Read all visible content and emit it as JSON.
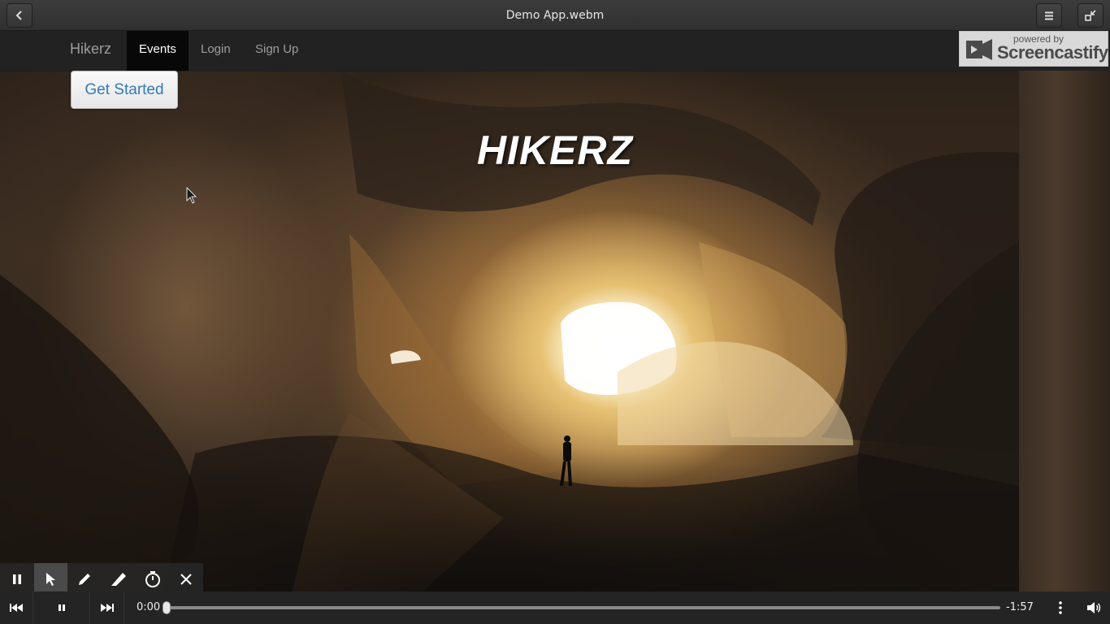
{
  "window": {
    "title": "Demo App.webm",
    "back_icon": "chevron-left-icon",
    "menu_icon": "hamburger-menu-icon",
    "restore_icon": "unfullscreen-icon"
  },
  "site": {
    "brand": "Hikerz",
    "nav": [
      {
        "label": "Events",
        "active": true
      },
      {
        "label": "Login",
        "active": false
      },
      {
        "label": "Sign Up",
        "active": false
      }
    ],
    "cta": "Get Started",
    "hero_title": "HIKERZ"
  },
  "watermark": {
    "line1": "powered by",
    "line2": "Screencastify"
  },
  "annotation_toolbar": {
    "tools": [
      "pause-icon",
      "pointer-icon",
      "pen-icon",
      "eraser-icon",
      "timer-icon",
      "close-icon"
    ],
    "selected": "pointer-icon"
  },
  "playback": {
    "elapsed": "0:00",
    "remaining": "-1:57",
    "progress": 0.0,
    "state": "playing"
  },
  "colors": {
    "navbar": "#222222",
    "nav_active": "#080808",
    "link_blue": "#337ab7"
  }
}
